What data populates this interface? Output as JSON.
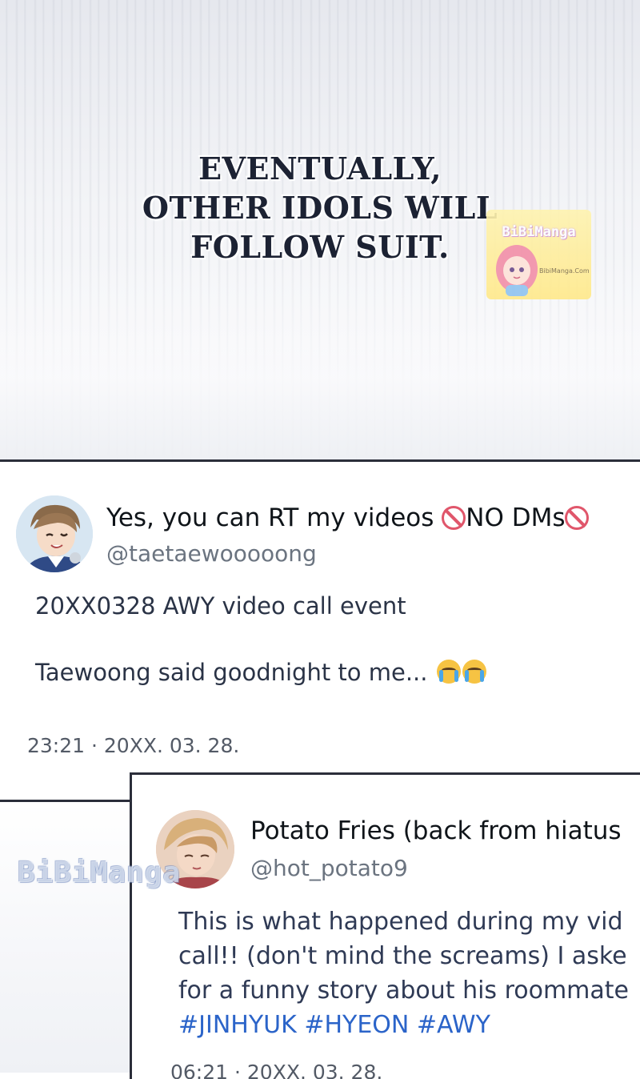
{
  "panel": {
    "caption_lines": [
      "EVENTUALLY,",
      "OTHER IDOLS WILL",
      "FOLLOW SUIT."
    ]
  },
  "watermarks": {
    "logo_text": "BiBiManga",
    "logo_site": "BibiManga.Com",
    "overlay_text": "BiBiManga"
  },
  "tweets": [
    {
      "display_name": "Yes, you can RT my videos ",
      "display_name_mid": "NO DMs",
      "name_icons": [
        "no-entry-icon",
        "no-entry-icon"
      ],
      "handle": "@taetaewooooong",
      "lines": [
        "20XX0328 AWY video call event",
        "Taewoong said goodnight to me..."
      ],
      "line_emojis": [
        "loudly-crying-face-icon",
        "loudly-crying-face-icon"
      ],
      "timestamp": "23:21 · 20XX. 03. 28."
    },
    {
      "display_name": "Potato Fries (back from hiatus",
      "handle": "@hot_potato9",
      "lines": [
        "This is what happened during my vid",
        "call!! (don't mind the screams) I aske",
        "for a funny story about his roommate"
      ],
      "hashtags": "#JINHYUK #HYEON #AWY",
      "timestamp": "06:21 · 20XX. 03. 28."
    }
  ],
  "colors": {
    "hashtag": "#2b64c9",
    "no_entry": "#e0566b",
    "divider": "#2b2e3a"
  }
}
